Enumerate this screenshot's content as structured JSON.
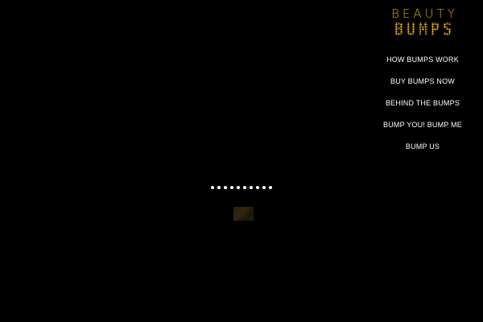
{
  "logo": {
    "line1": "BEAUTY",
    "line2": "BUMPS",
    "color": "#d9a419"
  },
  "nav": {
    "items": [
      {
        "label": "HOW BUMPS WORK"
      },
      {
        "label": "BUY BUMPS NOW"
      },
      {
        "label": "BEHIND THE BUMPS"
      },
      {
        "label": "BUMP YOU! BUMP ME"
      },
      {
        "label": "BUMP US"
      }
    ]
  },
  "loader": {
    "dot_count": 10,
    "dot_color": "#ffffff"
  },
  "colors": {
    "background": "#000000",
    "nav_text": "#ffffff"
  }
}
